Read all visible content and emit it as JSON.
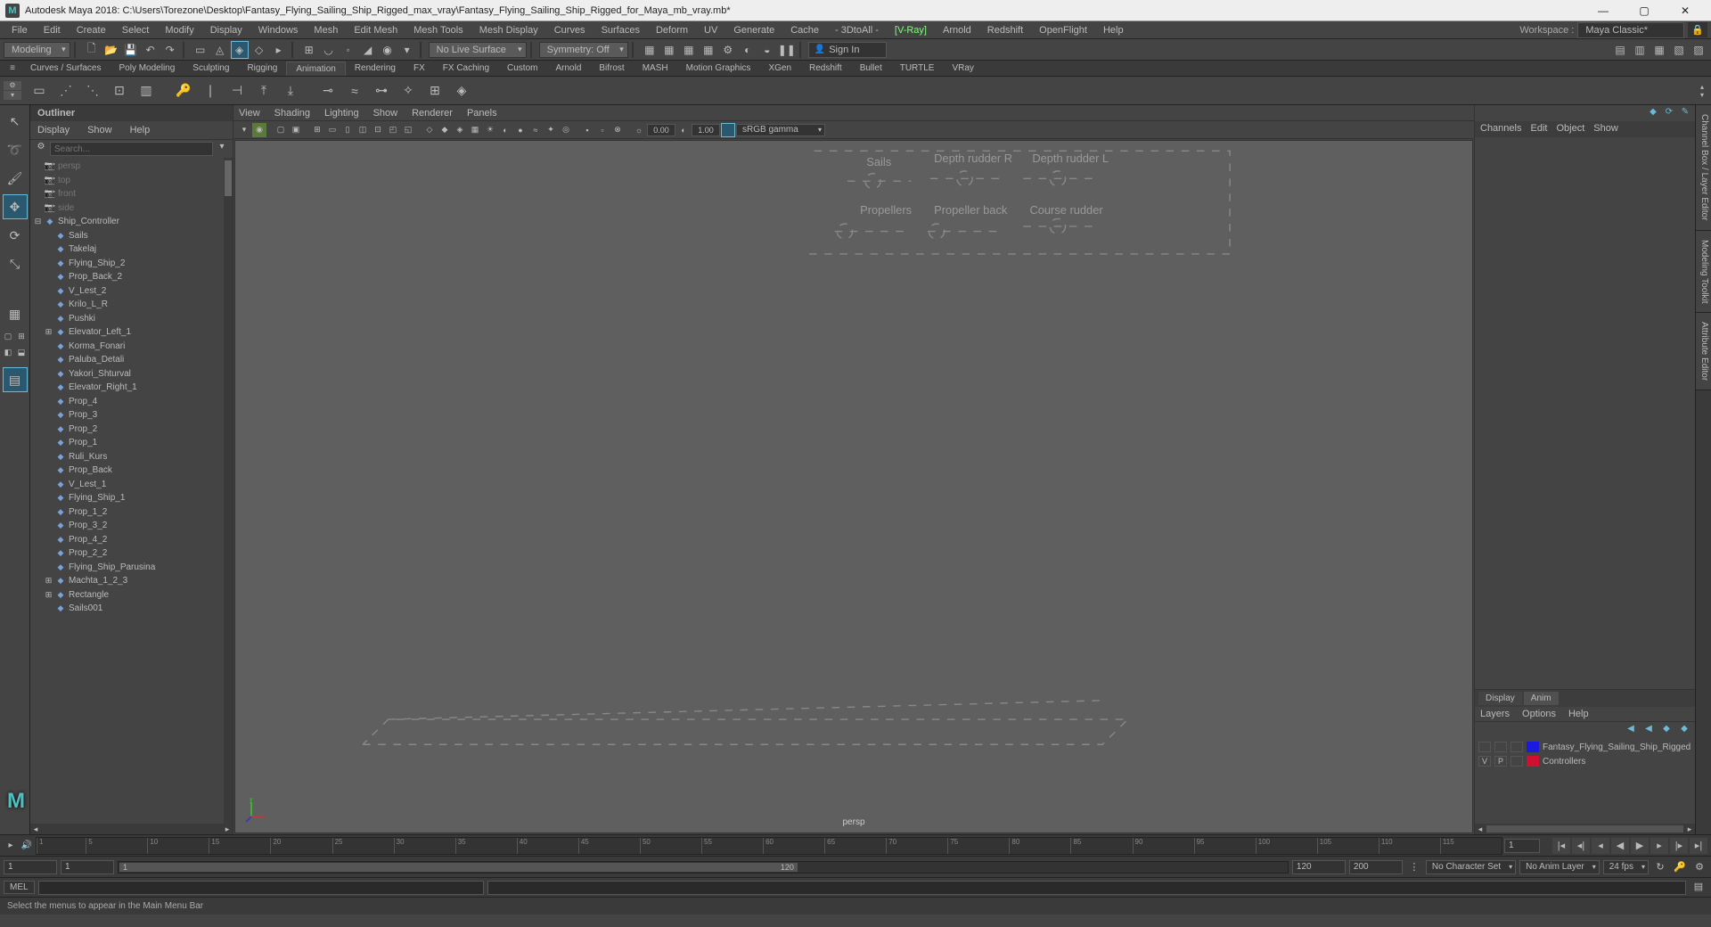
{
  "title": "Autodesk Maya 2018: C:\\Users\\Torezone\\Desktop\\Fantasy_Flying_Sailing_Ship_Rigged_max_vray\\Fantasy_Flying_Sailing_Ship_Rigged_for_Maya_mb_vray.mb*",
  "mainmenu": [
    "File",
    "Edit",
    "Create",
    "Select",
    "Modify",
    "Display",
    "Windows",
    "Mesh",
    "Edit Mesh",
    "Mesh Tools",
    "Mesh Display",
    "Curves",
    "Surfaces",
    "Deform",
    "UV",
    "Generate",
    "Cache",
    "- 3DtoAll -",
    "[V-Ray]",
    "Arnold",
    "Redshift",
    "OpenFlight",
    "Help"
  ],
  "workspace_label": "Workspace :",
  "workspace_value": "Maya Classic*",
  "mode_dropdown": "Modeling",
  "live_surface": "No Live Surface",
  "symmetry": "Symmetry: Off",
  "signin": "Sign In",
  "shelftabs": [
    "Curves / Surfaces",
    "Poly Modeling",
    "Sculpting",
    "Rigging",
    "Animation",
    "Rendering",
    "FX",
    "FX Caching",
    "Custom",
    "Arnold",
    "Bifrost",
    "MASH",
    "Motion Graphics",
    "XGen",
    "Redshift",
    "Bullet",
    "TURTLE",
    "VRay"
  ],
  "shelf_active": 4,
  "outliner": {
    "title": "Outliner",
    "menu": [
      "Display",
      "Show",
      "Help"
    ],
    "search_placeholder": "Search...",
    "cameras": [
      "persp",
      "top",
      "front",
      "side"
    ],
    "root": "Ship_Controller",
    "items": [
      "Sails",
      "Takelaj",
      "Flying_Ship_2",
      "Prop_Back_2",
      "V_Lest_2",
      "Krilo_L_R",
      "Pushki",
      "Elevator_Left_1",
      "Korma_Fonari",
      "Paluba_Detali",
      "Yakori_Shturval",
      "Elevator_Right_1",
      "Prop_4",
      "Prop_3",
      "Prop_2",
      "Prop_1",
      "Ruli_Kurs",
      "Prop_Back",
      "V_Lest_1",
      "Flying_Ship_1",
      "Prop_1_2",
      "Prop_3_2",
      "Prop_4_2",
      "Prop_2_2",
      "Flying_Ship_Parusina",
      "Machta_1_2_3",
      "Rectangle",
      "Sails001"
    ]
  },
  "vp_menu": [
    "View",
    "Shading",
    "Lighting",
    "Show",
    "Renderer",
    "Panels"
  ],
  "vp_num1": "0.00",
  "vp_num2": "1.00",
  "vp_gamma": "sRGB gamma",
  "vp_camera": "persp",
  "hud_sliders": [
    "Sails",
    "Depth rudder R",
    "Depth rudder L",
    "Propellers",
    "Propeller back",
    "Course rudder"
  ],
  "right": {
    "menu": [
      "Channels",
      "Edit",
      "Object",
      "Show"
    ],
    "disp_tabs": [
      "Display",
      "Anim"
    ],
    "layers_menu": [
      "Layers",
      "Options",
      "Help"
    ],
    "layers": [
      {
        "v": "",
        "p": "",
        "color": "#1a1ae0",
        "name": "Fantasy_Flying_Sailing_Ship_Rigged"
      },
      {
        "v": "V",
        "p": "P",
        "color": "#d01030",
        "name": "Controllers"
      }
    ]
  },
  "sidetabs": [
    "Channel Box / Layer Editor",
    "Modeling Toolkit",
    "Attribute Editor"
  ],
  "range": {
    "start": "1",
    "rstart": "1",
    "rend": "120",
    "end": "200",
    "cur": "1"
  },
  "charset": "No Character Set",
  "animlayer": "No Anim Layer",
  "fps": "24 fps",
  "mel": "MEL",
  "helpline": "Select the menus to appear in the Main Menu Bar",
  "ticks": [
    1,
    5,
    10,
    15,
    20,
    25,
    30,
    35,
    40,
    45,
    50,
    55,
    60,
    65,
    70,
    75,
    80,
    85,
    90,
    95,
    100,
    105,
    110,
    115,
    120
  ]
}
